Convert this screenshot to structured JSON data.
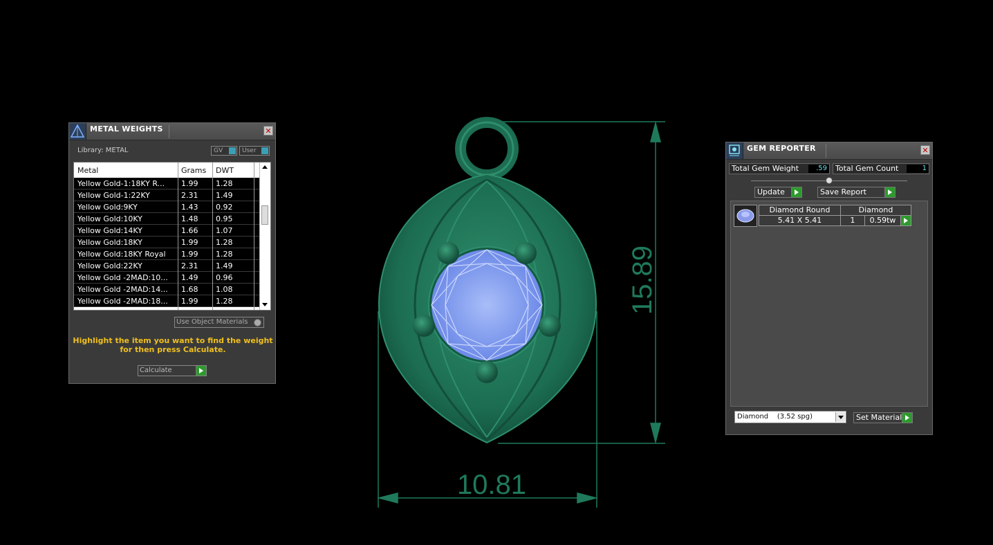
{
  "viewport": {
    "dimension_width": "10.81",
    "dimension_height": "15.89"
  },
  "metal_panel": {
    "title": "METAL WEIGHTS",
    "library_label": "Library: METAL",
    "toggle_gv": "GV",
    "toggle_user": "User",
    "columns": [
      "Metal",
      "Grams",
      "DWT"
    ],
    "rows": [
      {
        "metal": "Yellow Gold-1:18KY R...",
        "grams": "1.99",
        "dwt": "1.28"
      },
      {
        "metal": "Yellow Gold-1:22KY",
        "grams": "2.31",
        "dwt": "1.49"
      },
      {
        "metal": "Yellow Gold:9KY",
        "grams": "1.43",
        "dwt": "0.92"
      },
      {
        "metal": "Yellow Gold:10KY",
        "grams": "1.48",
        "dwt": "0.95"
      },
      {
        "metal": "Yellow Gold:14KY",
        "grams": "1.66",
        "dwt": "1.07"
      },
      {
        "metal": "Yellow Gold:18KY",
        "grams": "1.99",
        "dwt": "1.28"
      },
      {
        "metal": "Yellow Gold:18KY Royal",
        "grams": "1.99",
        "dwt": "1.28"
      },
      {
        "metal": "Yellow Gold:22KY",
        "grams": "2.31",
        "dwt": "1.49"
      },
      {
        "metal": "Yellow Gold -2MAD:10...",
        "grams": "1.49",
        "dwt": "0.96"
      },
      {
        "metal": "Yellow Gold -2MAD:14...",
        "grams": "1.68",
        "dwt": "1.08"
      },
      {
        "metal": "Yellow Gold -2MAD:18...",
        "grams": "1.99",
        "dwt": "1.28"
      }
    ],
    "use_object_materials": "Use Object Materials",
    "hint": "Highlight the item you want to find the weight for then press Calculate.",
    "calculate_label": "Calculate"
  },
  "gem_panel": {
    "title": "GEM REPORTER",
    "total_weight_label": "Total Gem Weight",
    "total_weight_value": ".59",
    "total_count_label": "Total Gem Count",
    "total_count_value": "1",
    "update_label": "Update",
    "save_report_label": "Save Report",
    "gem": {
      "name": "Diamond Round",
      "material": "Diamond",
      "size": "5.41 X 5.41",
      "count": "1",
      "weight": "0.59tw"
    },
    "material_select": "Diamond    (3.52 spg)",
    "set_material_label": "Set Material"
  },
  "colors": {
    "model_green": "#1f7a5c",
    "gem_blue": "#7d9bf0",
    "accent_yellow": "#f0c020",
    "play_green": "#2d9a2d"
  }
}
